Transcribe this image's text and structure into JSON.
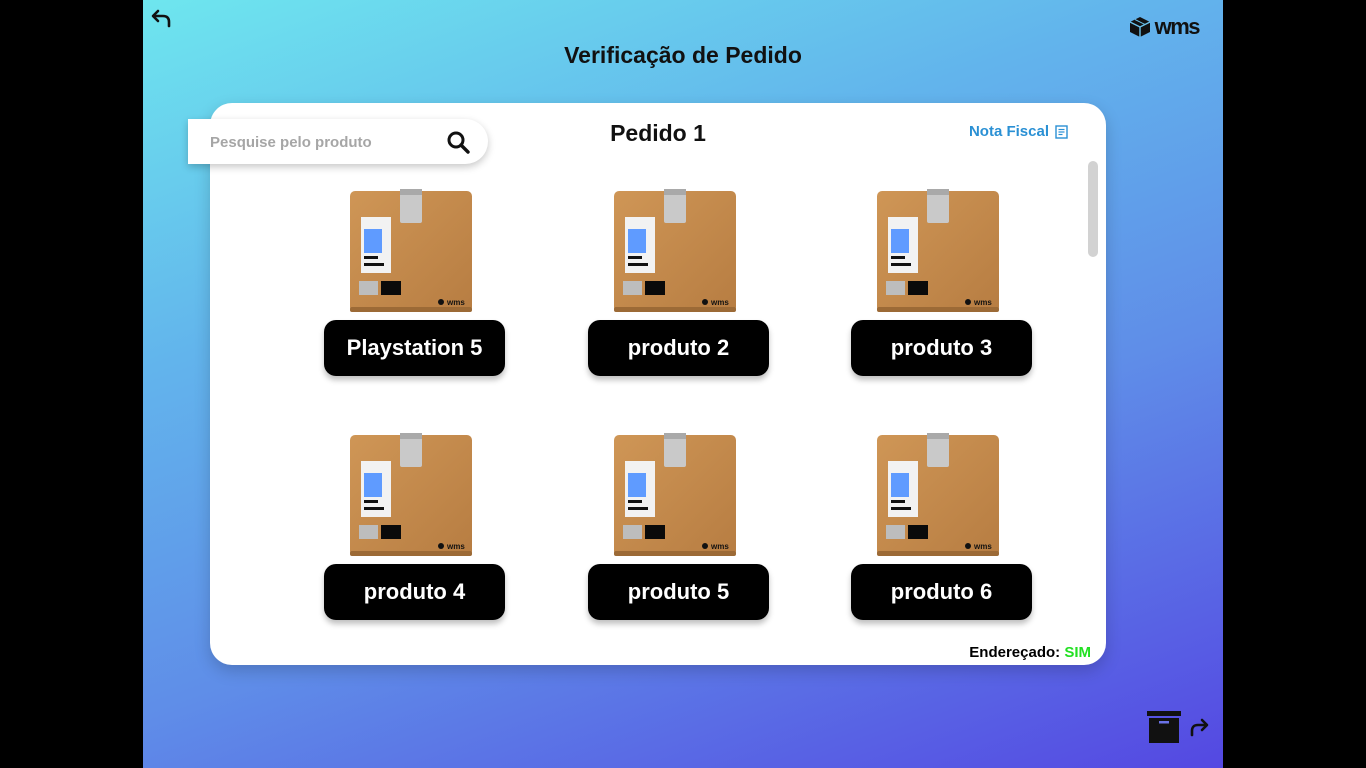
{
  "header": {
    "title": "Verificação de Pedido",
    "logo_text": "wms",
    "back_icon": "undo-arrow-icon",
    "logo_icon": "cube-logo-icon"
  },
  "order": {
    "title": "Pedido 1",
    "invoice_label": "Nota Fiscal",
    "invoice_icon": "document-icon"
  },
  "search": {
    "placeholder": "Pesquise pelo produto",
    "value": "",
    "icon": "search-icon"
  },
  "products": [
    {
      "label": "Playstation 5",
      "icon": "package-box-icon"
    },
    {
      "label": "produto 2",
      "icon": "package-box-icon"
    },
    {
      "label": "produto 3",
      "icon": "package-box-icon"
    },
    {
      "label": "produto 4",
      "icon": "package-box-icon"
    },
    {
      "label": "produto 5",
      "icon": "package-box-icon"
    },
    {
      "label": "produto 6",
      "icon": "package-box-icon"
    }
  ],
  "status": {
    "label": "Endereçado:",
    "value": "SIM"
  },
  "footer": {
    "archive_icon": "archive-box-icon",
    "forward_icon": "forward-arrow-icon"
  },
  "colors": {
    "gradient_start": "#6ee6ee",
    "gradient_end": "#5448e2",
    "accent_link": "#2a90d4",
    "status_yes": "#22e022",
    "label_bg": "#000000",
    "box": "#c48a4c"
  }
}
